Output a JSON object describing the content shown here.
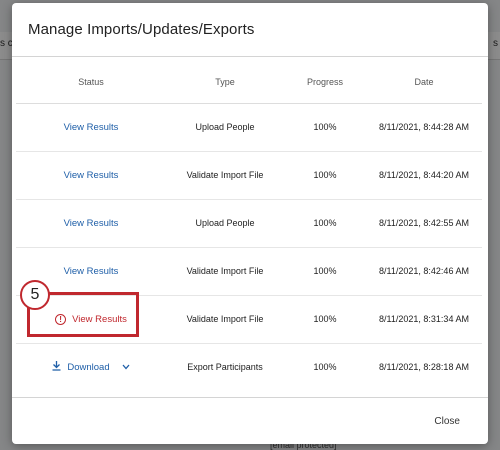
{
  "background": {
    "left_text": "s c",
    "right_text": "s",
    "bottom_text": "[email protected]"
  },
  "dialog": {
    "title": "Manage Imports/Updates/Exports",
    "close_label": "Close"
  },
  "table": {
    "headers": {
      "status": "Status",
      "type": "Type",
      "progress": "Progress",
      "date": "Date"
    },
    "rows": [
      {
        "status": "View Results",
        "type": "Upload People",
        "progress": "100%",
        "date": "8/11/2021, 8:44:28 AM"
      },
      {
        "status": "View Results",
        "type": "Validate Import File",
        "progress": "100%",
        "date": "8/11/2021, 8:44:20 AM"
      },
      {
        "status": "View Results",
        "type": "Upload People",
        "progress": "100%",
        "date": "8/11/2021, 8:42:55 AM"
      },
      {
        "status": "View Results",
        "type": "Validate Import File",
        "progress": "100%",
        "date": "8/11/2021, 8:42:46 AM"
      },
      {
        "status": "View Results",
        "status_state": "error",
        "type": "Validate Import File",
        "progress": "100%",
        "date": "8/11/2021, 8:31:34 AM"
      },
      {
        "status": "Download",
        "type": "Export Participants",
        "progress": "100%",
        "date": "8/11/2021, 8:28:18 AM"
      }
    ]
  },
  "annotation": {
    "step_number": "5"
  },
  "icons": {
    "error": "exclamation-circle-icon",
    "download": "download-icon",
    "chevron": "chevron-down-icon"
  },
  "colors": {
    "link": "#1f5fa8",
    "error": "#c0282e",
    "annotation": "#c0282e"
  }
}
